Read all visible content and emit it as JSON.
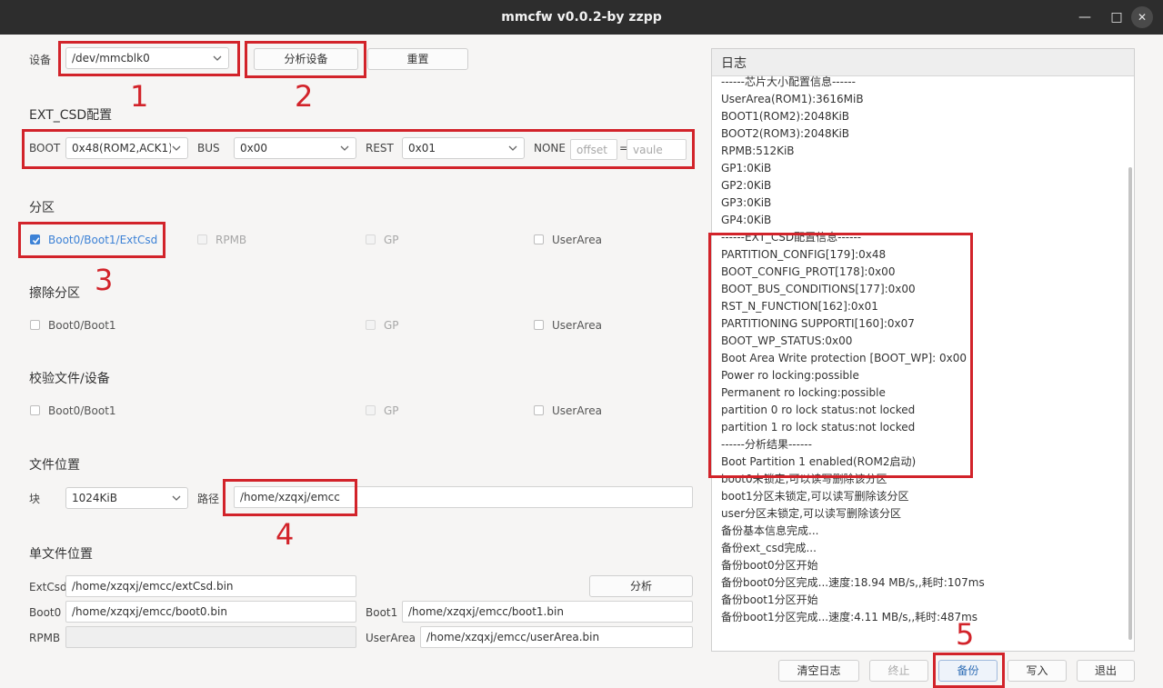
{
  "window": {
    "title": "mmcfw v0.0.2-by zzpp"
  },
  "device": {
    "label": "设备",
    "value": "/dev/mmcblk0",
    "analyze_btn": "分析设备",
    "reset_btn": "重置"
  },
  "ext_csd": {
    "heading": "EXT_CSD配置",
    "boot_label": "BOOT",
    "boot_value": "0x48(ROM2,ACK1)",
    "bus_label": "BUS",
    "bus_value": "0x00",
    "rest_label": "REST",
    "rest_value": "0x01",
    "none_label": "NONE",
    "offset_placeholder": "offset",
    "equals": "=",
    "value_placeholder": "vaule"
  },
  "partition": {
    "heading": "分区",
    "items": [
      "Boot0/Boot1/ExtCsd",
      "RPMB",
      "GP",
      "UserArea"
    ]
  },
  "erase": {
    "heading": "擦除分区",
    "items": [
      "Boot0/Boot1",
      "GP",
      "UserArea"
    ]
  },
  "verify": {
    "heading": "校验文件/设备",
    "items": [
      "Boot0/Boot1",
      "GP",
      "UserArea"
    ]
  },
  "file_location": {
    "heading": "文件位置",
    "block_label": "块",
    "block_value": "1024KiB",
    "path_label": "路径",
    "path_value": "/home/xzqxj/emcc"
  },
  "single_file": {
    "heading": "单文件位置",
    "extcsd_label": "ExtCsd",
    "extcsd_value": "/home/xzqxj/emcc/extCsd.bin",
    "analyze_btn": "分析",
    "boot0_label": "Boot0",
    "boot0_value": "/home/xzqxj/emcc/boot0.bin",
    "boot1_label": "Boot1",
    "boot1_value": "/home/xzqxj/emcc/boot1.bin",
    "rpmb_label": "RPMB",
    "rpmb_value": "",
    "userarea_label": "UserArea",
    "userarea_value": "/home/xzqxj/emcc/userArea.bin"
  },
  "log": {
    "heading": "日志",
    "lines": [
      "------芯片大小配置信息------",
      "UserArea(ROM1):3616MiB",
      "BOOT1(ROM2):2048KiB",
      "BOOT2(ROM3):2048KiB",
      "RPMB:512KiB",
      "GP1:0KiB",
      "GP2:0KiB",
      "GP3:0KiB",
      "GP4:0KiB",
      "------EXT_CSD配置信息------",
      "PARTITION_CONFIG[179]:0x48",
      "BOOT_CONFIG_PROT[178]:0x00",
      "BOOT_BUS_CONDITIONS[177]:0x00",
      "RST_N_FUNCTION[162]:0x01",
      "PARTITIONING SUPPORTI[160]:0x07",
      "BOOT_WP_STATUS:0x00",
      "Boot Area Write protection [BOOT_WP]: 0x00",
      "Power ro locking:possible",
      "Permanent ro locking:possible",
      "partition 0 ro lock status:not locked",
      "partition 1 ro lock status:not locked",
      "------分析结果------",
      "Boot Partition 1 enabled(ROM2启动)",
      "boot0未锁定,可以读写删除该分区",
      "boot1分区未锁定,可以读写删除该分区",
      "user分区未锁定,可以读写删除该分区",
      "备份基本信息完成...",
      "备份ext_csd完成...",
      "备份boot0分区开始",
      "备份boot0分区完成...速度:18.94 MB/s,,耗时:107ms",
      "备份boot1分区开始",
      "备份boot1分区完成...速度:4.11 MB/s,,耗时:487ms"
    ]
  },
  "actions": {
    "clear_log": "清空日志",
    "stop": "终止",
    "backup": "备份",
    "write": "写入",
    "exit": "退出"
  },
  "annotations": [
    "1",
    "2",
    "3",
    "4",
    "5"
  ],
  "colors": {
    "annotation_red": "#d2232a",
    "accent_blue": "#3d82d6"
  }
}
